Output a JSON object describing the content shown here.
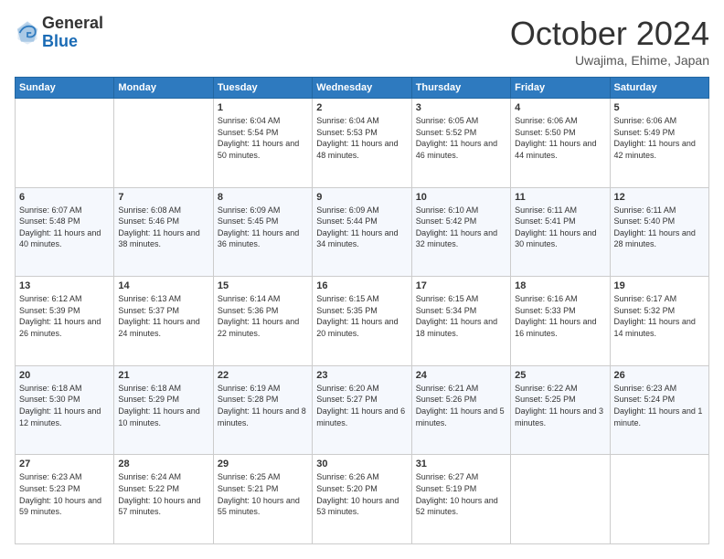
{
  "logo": {
    "line1": "General",
    "line2": "Blue"
  },
  "header": {
    "month": "October 2024",
    "location": "Uwajima, Ehime, Japan"
  },
  "weekdays": [
    "Sunday",
    "Monday",
    "Tuesday",
    "Wednesday",
    "Thursday",
    "Friday",
    "Saturday"
  ],
  "weeks": [
    [
      {
        "day": "",
        "info": ""
      },
      {
        "day": "",
        "info": ""
      },
      {
        "day": "1",
        "info": "Sunrise: 6:04 AM\nSunset: 5:54 PM\nDaylight: 11 hours and 50 minutes."
      },
      {
        "day": "2",
        "info": "Sunrise: 6:04 AM\nSunset: 5:53 PM\nDaylight: 11 hours and 48 minutes."
      },
      {
        "day": "3",
        "info": "Sunrise: 6:05 AM\nSunset: 5:52 PM\nDaylight: 11 hours and 46 minutes."
      },
      {
        "day": "4",
        "info": "Sunrise: 6:06 AM\nSunset: 5:50 PM\nDaylight: 11 hours and 44 minutes."
      },
      {
        "day": "5",
        "info": "Sunrise: 6:06 AM\nSunset: 5:49 PM\nDaylight: 11 hours and 42 minutes."
      }
    ],
    [
      {
        "day": "6",
        "info": "Sunrise: 6:07 AM\nSunset: 5:48 PM\nDaylight: 11 hours and 40 minutes."
      },
      {
        "day": "7",
        "info": "Sunrise: 6:08 AM\nSunset: 5:46 PM\nDaylight: 11 hours and 38 minutes."
      },
      {
        "day": "8",
        "info": "Sunrise: 6:09 AM\nSunset: 5:45 PM\nDaylight: 11 hours and 36 minutes."
      },
      {
        "day": "9",
        "info": "Sunrise: 6:09 AM\nSunset: 5:44 PM\nDaylight: 11 hours and 34 minutes."
      },
      {
        "day": "10",
        "info": "Sunrise: 6:10 AM\nSunset: 5:42 PM\nDaylight: 11 hours and 32 minutes."
      },
      {
        "day": "11",
        "info": "Sunrise: 6:11 AM\nSunset: 5:41 PM\nDaylight: 11 hours and 30 minutes."
      },
      {
        "day": "12",
        "info": "Sunrise: 6:11 AM\nSunset: 5:40 PM\nDaylight: 11 hours and 28 minutes."
      }
    ],
    [
      {
        "day": "13",
        "info": "Sunrise: 6:12 AM\nSunset: 5:39 PM\nDaylight: 11 hours and 26 minutes."
      },
      {
        "day": "14",
        "info": "Sunrise: 6:13 AM\nSunset: 5:37 PM\nDaylight: 11 hours and 24 minutes."
      },
      {
        "day": "15",
        "info": "Sunrise: 6:14 AM\nSunset: 5:36 PM\nDaylight: 11 hours and 22 minutes."
      },
      {
        "day": "16",
        "info": "Sunrise: 6:15 AM\nSunset: 5:35 PM\nDaylight: 11 hours and 20 minutes."
      },
      {
        "day": "17",
        "info": "Sunrise: 6:15 AM\nSunset: 5:34 PM\nDaylight: 11 hours and 18 minutes."
      },
      {
        "day": "18",
        "info": "Sunrise: 6:16 AM\nSunset: 5:33 PM\nDaylight: 11 hours and 16 minutes."
      },
      {
        "day": "19",
        "info": "Sunrise: 6:17 AM\nSunset: 5:32 PM\nDaylight: 11 hours and 14 minutes."
      }
    ],
    [
      {
        "day": "20",
        "info": "Sunrise: 6:18 AM\nSunset: 5:30 PM\nDaylight: 11 hours and 12 minutes."
      },
      {
        "day": "21",
        "info": "Sunrise: 6:18 AM\nSunset: 5:29 PM\nDaylight: 11 hours and 10 minutes."
      },
      {
        "day": "22",
        "info": "Sunrise: 6:19 AM\nSunset: 5:28 PM\nDaylight: 11 hours and 8 minutes."
      },
      {
        "day": "23",
        "info": "Sunrise: 6:20 AM\nSunset: 5:27 PM\nDaylight: 11 hours and 6 minutes."
      },
      {
        "day": "24",
        "info": "Sunrise: 6:21 AM\nSunset: 5:26 PM\nDaylight: 11 hours and 5 minutes."
      },
      {
        "day": "25",
        "info": "Sunrise: 6:22 AM\nSunset: 5:25 PM\nDaylight: 11 hours and 3 minutes."
      },
      {
        "day": "26",
        "info": "Sunrise: 6:23 AM\nSunset: 5:24 PM\nDaylight: 11 hours and 1 minute."
      }
    ],
    [
      {
        "day": "27",
        "info": "Sunrise: 6:23 AM\nSunset: 5:23 PM\nDaylight: 10 hours and 59 minutes."
      },
      {
        "day": "28",
        "info": "Sunrise: 6:24 AM\nSunset: 5:22 PM\nDaylight: 10 hours and 57 minutes."
      },
      {
        "day": "29",
        "info": "Sunrise: 6:25 AM\nSunset: 5:21 PM\nDaylight: 10 hours and 55 minutes."
      },
      {
        "day": "30",
        "info": "Sunrise: 6:26 AM\nSunset: 5:20 PM\nDaylight: 10 hours and 53 minutes."
      },
      {
        "day": "31",
        "info": "Sunrise: 6:27 AM\nSunset: 5:19 PM\nDaylight: 10 hours and 52 minutes."
      },
      {
        "day": "",
        "info": ""
      },
      {
        "day": "",
        "info": ""
      }
    ]
  ]
}
